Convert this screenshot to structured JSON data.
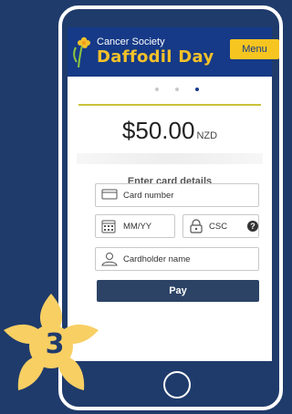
{
  "header": {
    "brand_small": "Cancer Society",
    "brand_big": "Daffodil Day",
    "menu_label": "Menu"
  },
  "pager": {
    "count": 3,
    "active_index": 2
  },
  "donation": {
    "amount": "$50.00",
    "currency": "NZD"
  },
  "form": {
    "title": "Enter card details",
    "card_number_placeholder": "Card number",
    "expiry_placeholder": "MM/YY",
    "csc_placeholder": "CSC",
    "help_label": "?",
    "cardholder_placeholder": "Cardholder name",
    "pay_label": "Pay"
  },
  "step_badge": {
    "number": "3"
  },
  "colors": {
    "background": "#1f3b6b",
    "header": "#163a87",
    "brand_yellow": "#f3c12a",
    "pay_button": "#2c4366"
  },
  "icons": {
    "logo": "daffodil-icon",
    "card": "credit-card-icon",
    "calendar": "calendar-icon",
    "lock": "lock-icon",
    "help": "help-icon",
    "user": "user-icon",
    "home": "home-button-icon",
    "badge": "daffodil-flower-icon"
  }
}
